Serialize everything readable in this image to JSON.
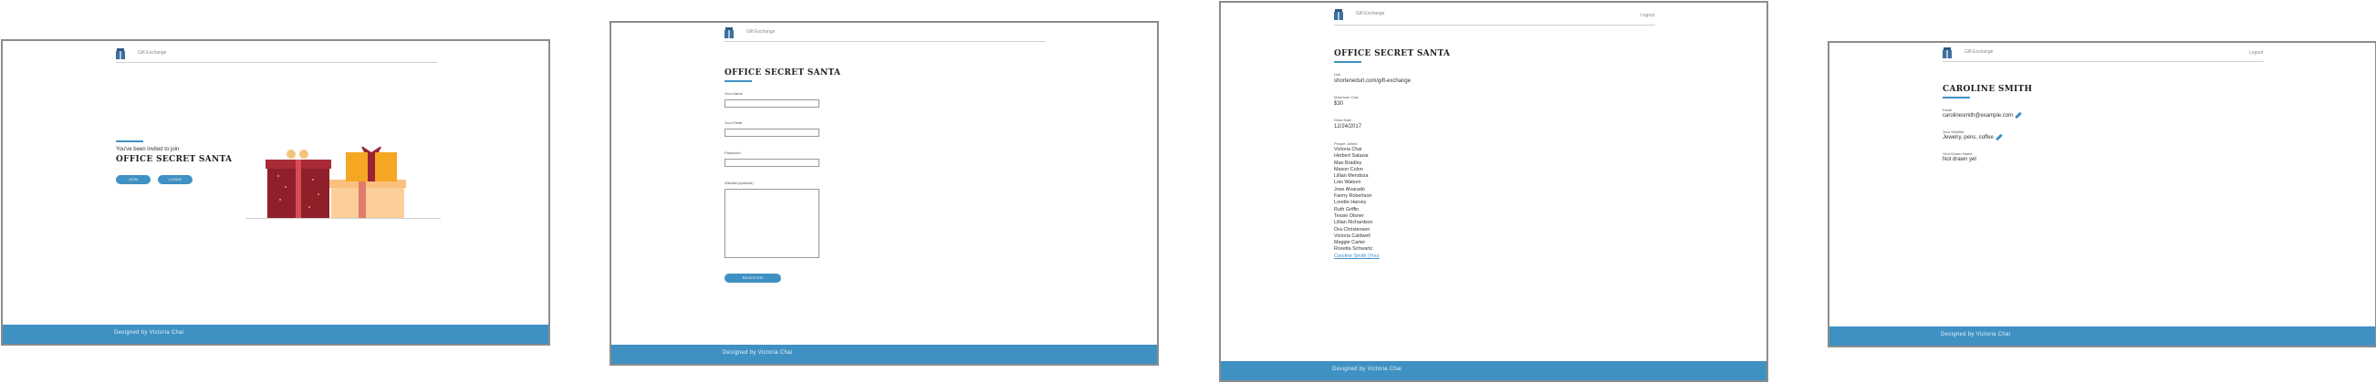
{
  "common": {
    "brand": "Gift Exchange",
    "logout": "Logout",
    "footer": "Designed by Victoria Chai",
    "colors": {
      "accent": "#3f91c3",
      "border": "#8c8c8c"
    }
  },
  "landing": {
    "invite_text": "You've been invited to join",
    "title": "OFFICE SECRET SANTA",
    "join_button": "JOIN",
    "login_button": "LOGIN"
  },
  "register": {
    "title": "OFFICE SECRET SANTA",
    "name_label": "Your Name",
    "email_label": "Your Email",
    "password_label": "Password",
    "wishlist_label": "Wishlist (optional)",
    "register_button": "REGISTER"
  },
  "detail": {
    "title": "OFFICE SECRET SANTA",
    "link_label": "Link",
    "link_value": "shortenedurl.com/gift-exchange",
    "max_cost_label": "Maximum Cost",
    "max_cost_value": "$30",
    "draw_date_label": "Draw Date",
    "draw_date_value": "12/24/2017",
    "people_label": "People Joined",
    "people": [
      "Victoria Chai",
      "Herbert Salazar",
      "Mae Bradley",
      "Mason Colon",
      "Lillian Mendoza",
      "Lois Watson",
      "Jose Alvarado",
      "Fanny Robertson",
      "Lorette Harvey",
      "Ruth Griffin",
      "Tessie Olsner",
      "Lillian Richardson",
      "Ora Christensen",
      "Victoria Caldwell",
      "Maggie Carter",
      "Rosetta Schwartz"
    ],
    "current_user": "Caroline Smith (You)"
  },
  "profile": {
    "title": "CAROLINE SMITH",
    "email_label": "Email",
    "email_value": "carolinesmith@example.com",
    "wishlist_label": "Your Wishlist",
    "wishlist_value": "Jewelry, pens, coffee",
    "drawn_label": "Your Drawn Name",
    "drawn_value": "Not drawn yet"
  }
}
